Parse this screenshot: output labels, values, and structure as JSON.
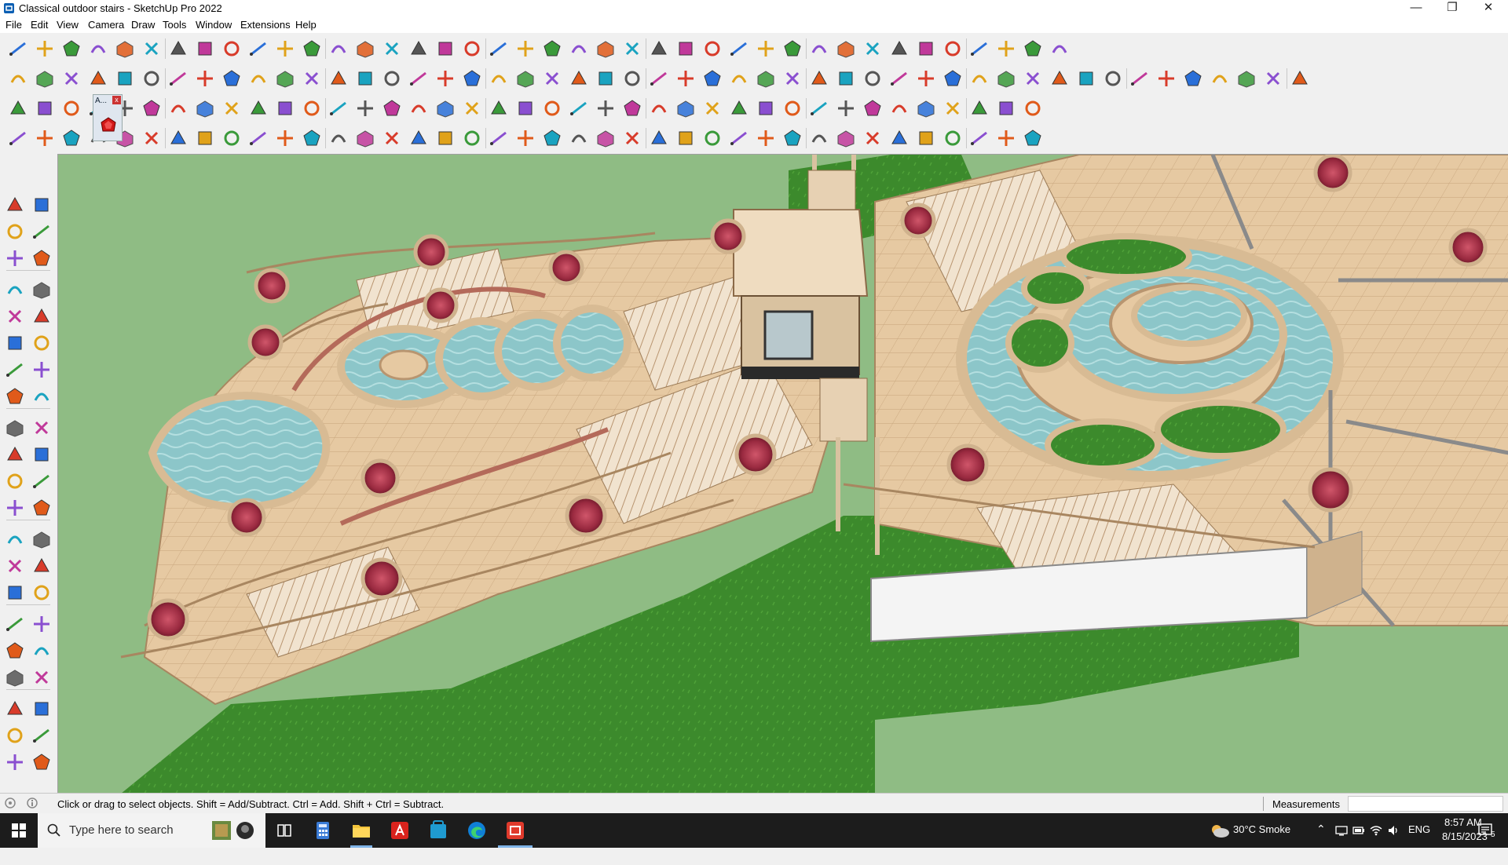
{
  "window": {
    "title": "Classical outdoor stairs - SketchUp Pro 2022",
    "app_icon": "sketchup-icon",
    "controls": [
      "minimize-icon",
      "restore-icon",
      "close-icon"
    ]
  },
  "menu": [
    "File",
    "Edit",
    "View",
    "Camera",
    "Draw",
    "Tools",
    "Window",
    "Extensions",
    "Help"
  ],
  "toolbars": {
    "rows": 4,
    "floating_label": "A..."
  },
  "left_toolbar": {
    "tools": [
      "select",
      "orbit",
      "paint-bucket",
      "eraser",
      "component",
      "tape-measure",
      "line",
      "freehand",
      "rectangle",
      "rotated-rectangle",
      "circle",
      "polygon",
      "arc",
      "pie",
      "2-point-arc",
      "3-point-arc",
      "move",
      "push-pull",
      "rotate",
      "follow-me",
      "scale",
      "offset",
      "tape",
      "text",
      "protractor",
      "axes",
      "dimension",
      "3d-text",
      "orbit",
      "pan",
      "zoom",
      "zoom-window",
      "zoom-extents",
      "previous",
      "position-camera",
      "look-around",
      "walk",
      "section-plane",
      "x-ray",
      "hidden-line",
      "wireframe",
      "shaded"
    ]
  },
  "status": {
    "hint": "Click or drag to select objects. Shift = Add/Subtract. Ctrl = Add. Shift + Ctrl = Subtract.",
    "measurements_label": "Measurements",
    "measurements_value": ""
  },
  "taskbar": {
    "search_placeholder": "Type here to search",
    "weather": "30°C  Smoke",
    "language": "ENG",
    "time": "8:57 AM",
    "date": "8/15/2023",
    "notification_count": "5",
    "apps": [
      "task-view-icon",
      "calculator-icon",
      "file-explorer-icon",
      "acrobat-icon",
      "store-icon",
      "edge-icon",
      "sketchup-icon"
    ]
  },
  "colors": {
    "sky_grass": "#8fbc84",
    "stone": "#e6c9a2",
    "water": "#8cc6c9",
    "grass": "#3c8a2c",
    "flower": "#a8324a"
  }
}
